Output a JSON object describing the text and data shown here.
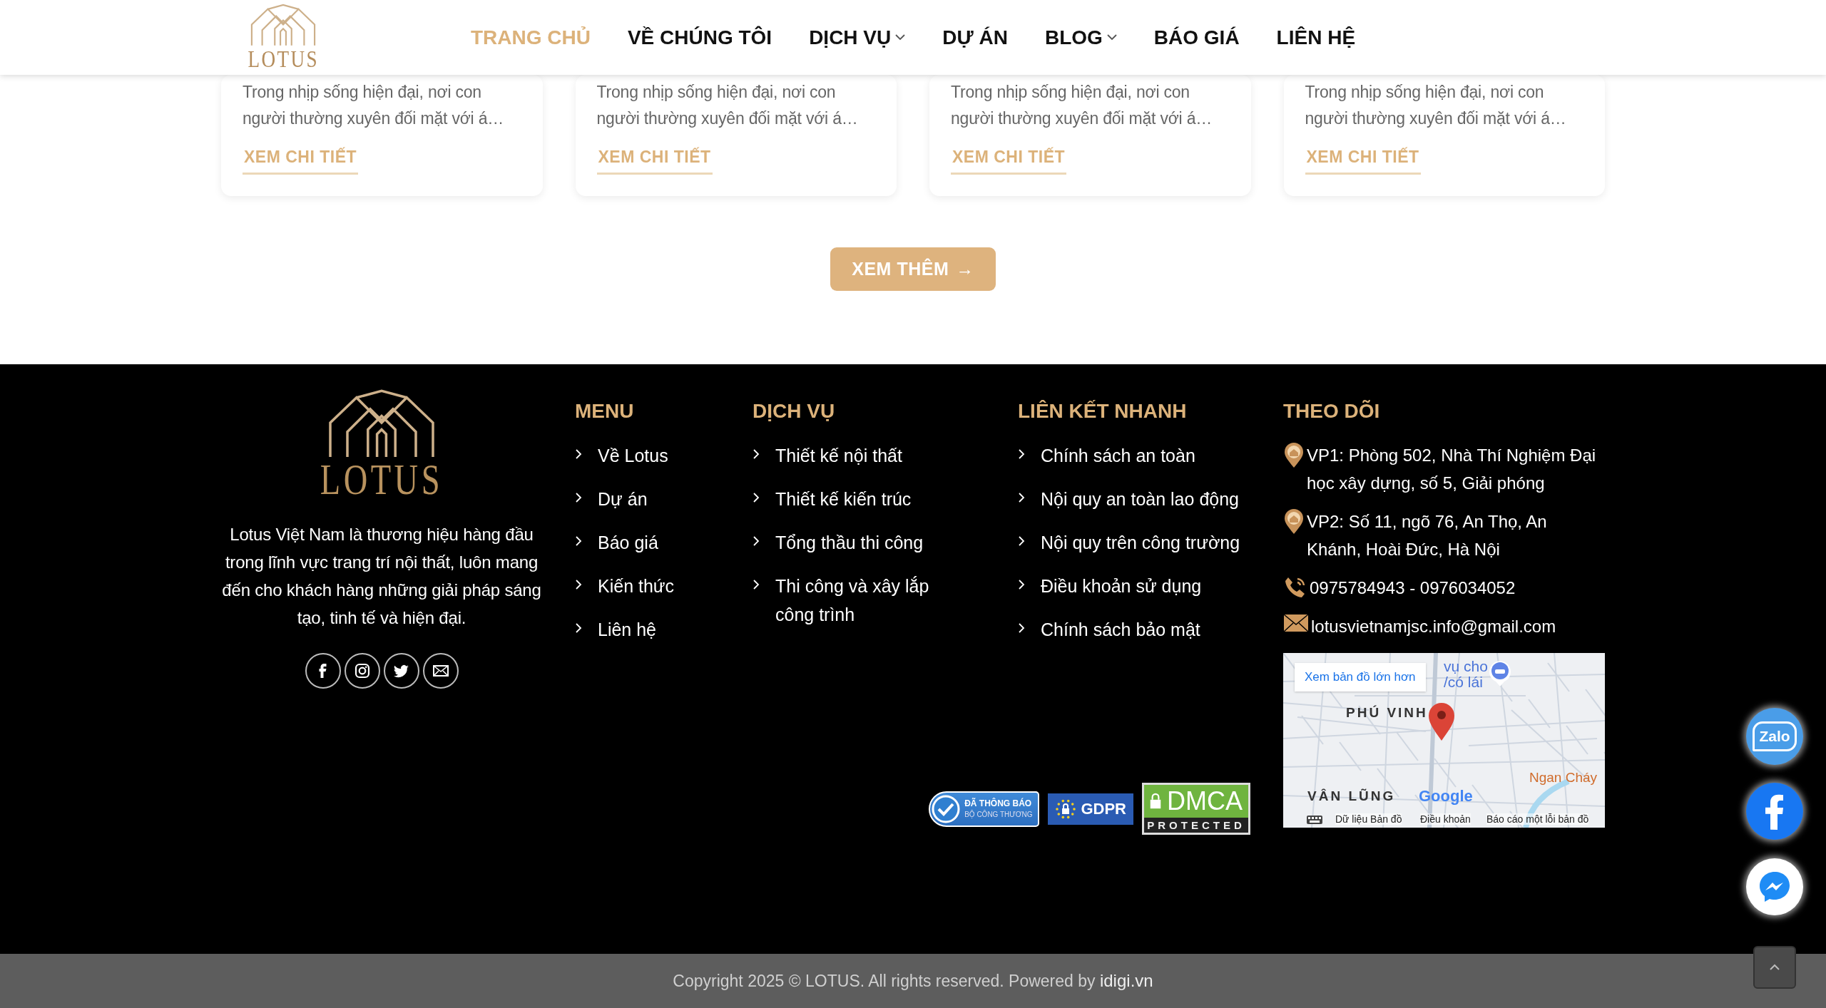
{
  "header": {
    "logo": "LOTUS",
    "nav": [
      {
        "label": "TRANG CHỦ",
        "selected": true,
        "dropdown": false
      },
      {
        "label": "VỀ CHÚNG TÔI",
        "selected": false,
        "dropdown": false
      },
      {
        "label": "DỊCH VỤ",
        "selected": false,
        "dropdown": true
      },
      {
        "label": "DỰ ÁN",
        "selected": false,
        "dropdown": false
      },
      {
        "label": "BLOG",
        "selected": false,
        "dropdown": true
      },
      {
        "label": "BÁO GIÁ",
        "selected": false,
        "dropdown": false
      },
      {
        "label": "LIÊN HỆ",
        "selected": false,
        "dropdown": false
      }
    ]
  },
  "posts": [
    {
      "excerpt": "Trong nhịp sống hiện đại, nơi con người thường xuyên đối mặt với á…",
      "link": "XEM CHI TIẾT"
    },
    {
      "excerpt": "Trong nhịp sống hiện đại, nơi con người thường xuyên đối mặt với á…",
      "link": "XEM CHI TIẾT"
    },
    {
      "excerpt": "Trong nhịp sống hiện đại, nơi con người thường xuyên đối mặt với á…",
      "link": "XEM CHI TIẾT"
    },
    {
      "excerpt": "Trong nhịp sống hiện đại, nơi con người thường xuyên đối mặt với á…",
      "link": "XEM CHI TIẾT"
    }
  ],
  "load_more": {
    "label": "XEM THÊM",
    "arrow": "→"
  },
  "footer": {
    "logo": "LOTUS",
    "about": "Lotus Việt Nam là thương hiệu hàng đầu trong lĩnh vực trang trí nội thất, luôn mang đến cho khách hàng những giải pháp sáng tạo, tinh tế và hiện đại.",
    "columns": [
      {
        "title": "MENU",
        "items": [
          "Về Lotus",
          "Dự án",
          "Báo giá",
          "Kiến thức",
          "Liên hệ"
        ]
      },
      {
        "title": "DỊCH VỤ",
        "items": [
          "Thiết kế nội thất",
          "Thiết kế kiến trúc",
          "Tổng thầu thi công",
          "Thi công và xây lắp công trình"
        ]
      },
      {
        "title": "LIÊN KẾT NHANH",
        "items": [
          "Chính sách an toàn",
          "Nội quy an toàn lao động",
          "Nội quy trên công trường",
          "Điều khoản sử dụng",
          "Chính sách bảo mật"
        ]
      }
    ],
    "contact": {
      "title": "THEO DÕI",
      "items": [
        {
          "kind": "address",
          "text": "VP1: Phòng 502, Nhà Thí Nghiệm Đại học xây dựng, số 5, Giải phóng"
        },
        {
          "kind": "address",
          "text": "VP2: Số 11, ngõ 76, An Thọ, An Khánh, Hoài Đức, Hà Nội"
        },
        {
          "kind": "phone",
          "text": "0975784943 - 0976034052"
        },
        {
          "kind": "email",
          "text": "lotusvietnamjsc.info@gmail.com"
        }
      ]
    },
    "map": {
      "link": "Xem bản đồ lớn hơn",
      "place_labels": [
        "vụ cho",
        "/có lái",
        "PHÚ VINH",
        "VÂN LŨNG",
        "Ngan Cháy"
      ],
      "brand": "Google",
      "bottom_links": [
        "Dữ liệu Bản đồ",
        "Điều khoản",
        "Báo cáo một lỗi bản đồ"
      ]
    },
    "badges": {
      "notice_title": "ĐÃ THÔNG BÁO",
      "notice_sub": "BỘ CÔNG THƯƠNG",
      "gdpr": "GDPR",
      "dmca": "DMCA",
      "dmca_sub": "PROTECTED"
    }
  },
  "copyright": {
    "text": "Copyright 2025 © LOTUS. All rights reserved. Powered by",
    "link": "idigi.vn"
  },
  "chat": {
    "zalo_label": "Zalo"
  }
}
